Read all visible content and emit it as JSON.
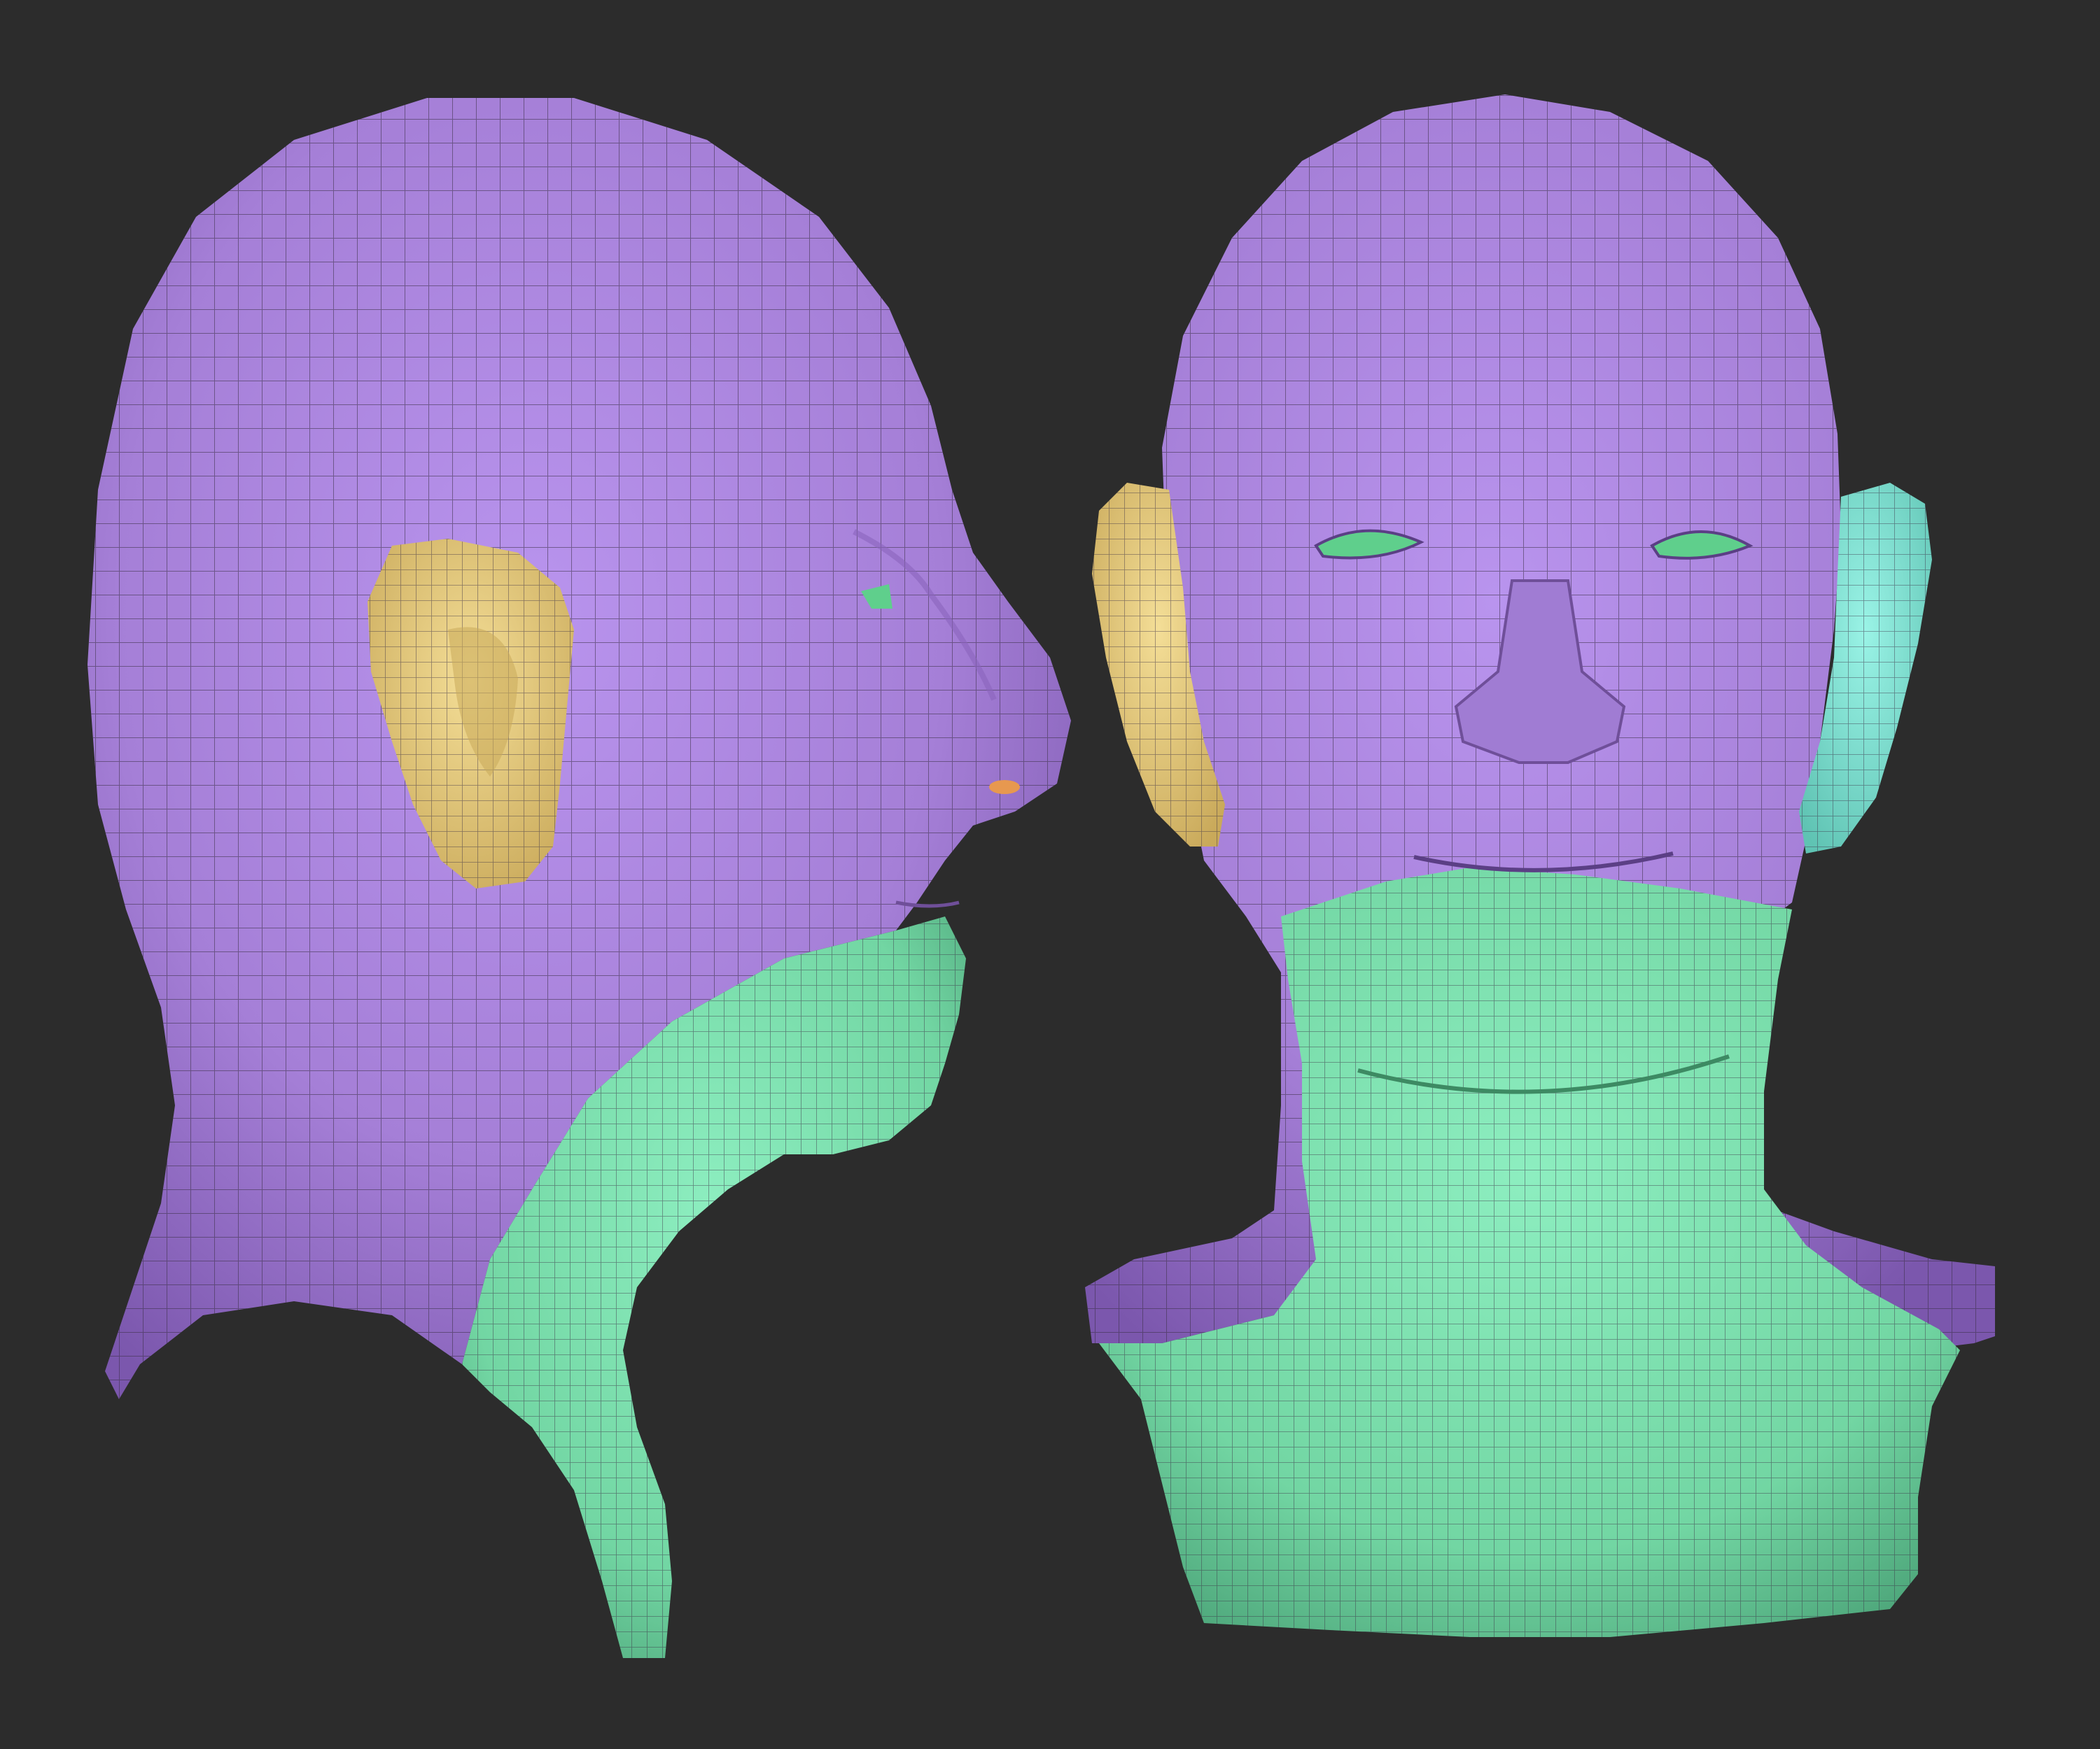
{
  "scene": {
    "background_color": "#2c2c2c",
    "models": [
      {
        "view": "side profile",
        "polygroups": [
          {
            "region": "head",
            "color": "#a77fd9"
          },
          {
            "region": "ear",
            "color": "#e8cd79"
          },
          {
            "region": "jaw-neck",
            "color": "#6fd4a0"
          },
          {
            "region": "nostril",
            "color": "#e7984f"
          },
          {
            "region": "eye",
            "color": "#5fcf8c"
          }
        ]
      },
      {
        "view": "front",
        "polygroups": [
          {
            "region": "head",
            "color": "#a77fd9"
          },
          {
            "region": "left-ear",
            "color": "#e8cd79"
          },
          {
            "region": "right-ear",
            "color": "#7ee8d8"
          },
          {
            "region": "jaw-neck-chest",
            "color": "#7ee5b2"
          },
          {
            "region": "eyes",
            "color": "#5fcf8c"
          }
        ]
      }
    ],
    "wireframe_color": "#3a2f45"
  }
}
